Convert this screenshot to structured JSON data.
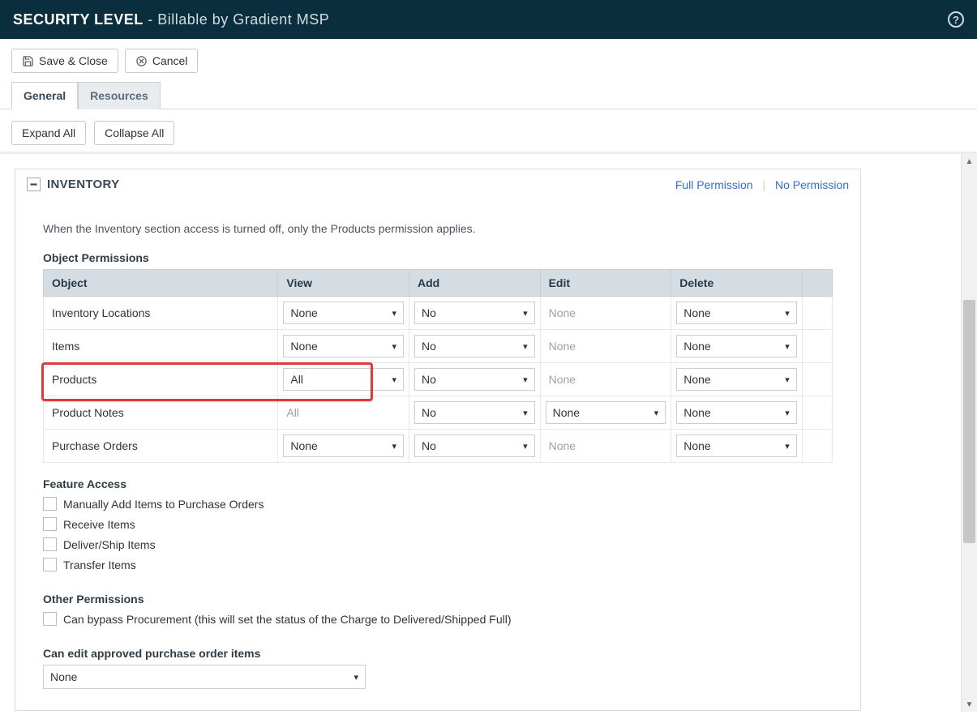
{
  "header": {
    "title_strong": "SECURITY LEVEL",
    "title_sub": " - Billable by Gradient MSP"
  },
  "toolbar": {
    "save_close": "Save & Close",
    "cancel": "Cancel"
  },
  "tabs": {
    "general": "General",
    "resources": "Resources"
  },
  "buttons": {
    "expand_all": "Expand All",
    "collapse_all": "Collapse All"
  },
  "panel": {
    "title": "INVENTORY",
    "full_permission": "Full Permission",
    "no_permission": "No Permission",
    "note": "When the Inventory section access is turned off, only the Products permission applies."
  },
  "objperm": {
    "heading": "Object Permissions",
    "cols": {
      "object": "Object",
      "view": "View",
      "add": "Add",
      "edit": "Edit",
      "delete": "Delete"
    },
    "rows": [
      {
        "object": "Inventory Locations",
        "view": "None",
        "add": "No",
        "edit": "None",
        "edit_static": true,
        "delete": "None"
      },
      {
        "object": "Items",
        "view": "None",
        "add": "No",
        "edit": "None",
        "edit_static": true,
        "delete": "None"
      },
      {
        "object": "Products",
        "view": "All",
        "add": "No",
        "edit": "None",
        "edit_static": true,
        "delete": "None"
      },
      {
        "object": "Product Notes",
        "view": "All",
        "view_static": true,
        "add": "No",
        "edit": "None",
        "delete": "None"
      },
      {
        "object": "Purchase Orders",
        "view": "None",
        "add": "No",
        "edit": "None",
        "edit_static": true,
        "delete": "None"
      }
    ]
  },
  "feature_access": {
    "heading": "Feature Access",
    "items": [
      "Manually Add Items to Purchase Orders",
      "Receive Items",
      "Deliver/Ship Items",
      "Transfer Items"
    ]
  },
  "other_perm": {
    "heading": "Other Permissions",
    "items": [
      "Can bypass Procurement (this will set the status of the Charge to Delivered/Shipped Full)"
    ]
  },
  "edit_po": {
    "heading": "Can edit approved purchase order items",
    "value": "None"
  }
}
